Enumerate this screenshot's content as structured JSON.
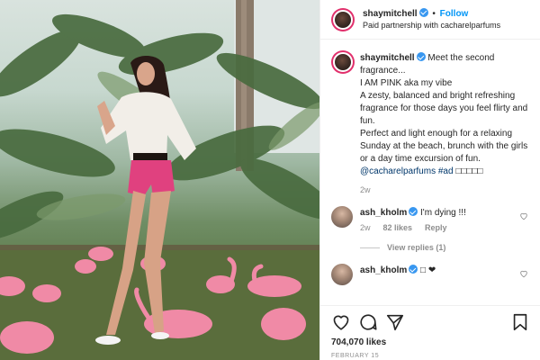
{
  "post": {
    "username": "shaymitchell",
    "follow_label": "Follow",
    "separator": "•",
    "partnership": "Paid partnership with cacharelparfums"
  },
  "caption": {
    "username": "shaymitchell",
    "line1": "Meet the second fragrance...",
    "line2": "I AM PINK aka my vibe",
    "line3": "A zesty, balanced and bright refreshing fragrance for those days you feel flirty and fun.",
    "line4": "Perfect and light enough for a relaxing Sunday at the beach, brunch with the girls or a day time excursion of fun.",
    "mention": "@cacharelparfums #ad",
    "emojis": "□□□□□",
    "time": "2w"
  },
  "comments": [
    {
      "username": "ash_kholm",
      "text": "I'm dying !!!",
      "time": "2w",
      "likes": "82 likes",
      "reply": "Reply",
      "view_replies": "View replies (1)"
    },
    {
      "username": "ash_kholm",
      "text": "□ ❤"
    }
  ],
  "actions": {
    "likes": "704,070 likes",
    "date": "FEBRUARY 15"
  },
  "icons": {
    "verified": "verified-badge-icon",
    "heart": "heart-icon",
    "comment": "comment-icon",
    "share": "share-icon",
    "bookmark": "bookmark-icon"
  },
  "colors": {
    "accent": "#0095f6",
    "verified": "#3897f0",
    "shorts": "#e0417f",
    "flamingo": "#f08aa6"
  }
}
